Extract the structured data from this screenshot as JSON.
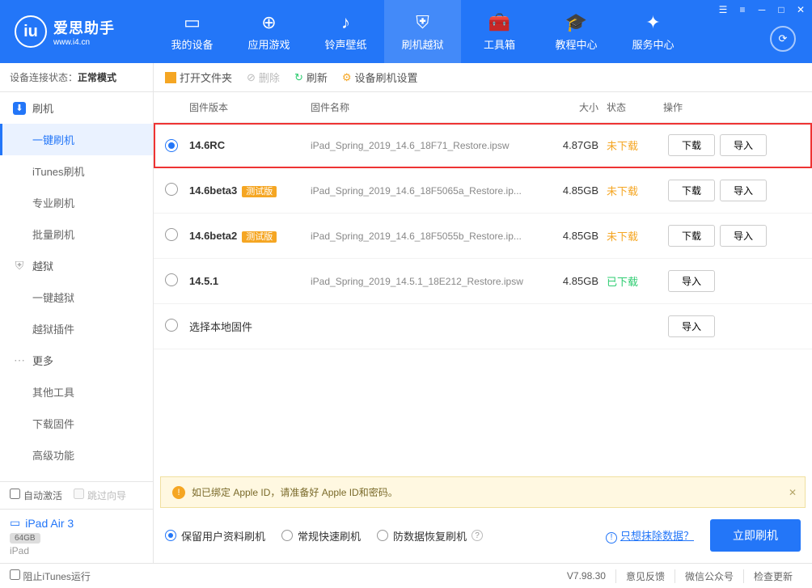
{
  "app": {
    "name": "爱思助手",
    "url": "www.i4.cn"
  },
  "nav": [
    {
      "label": "我的设备"
    },
    {
      "label": "应用游戏"
    },
    {
      "label": "铃声壁纸"
    },
    {
      "label": "刷机越狱"
    },
    {
      "label": "工具箱"
    },
    {
      "label": "教程中心"
    },
    {
      "label": "服务中心"
    }
  ],
  "status": {
    "prefix": "设备连接状态：",
    "value": "正常模式"
  },
  "sidebar": {
    "g1": "刷机",
    "items1": [
      "一键刷机",
      "iTunes刷机",
      "专业刷机",
      "批量刷机"
    ],
    "g2": "越狱",
    "items2": [
      "一键越狱",
      "越狱插件"
    ],
    "g3": "更多",
    "items3": [
      "其他工具",
      "下载固件",
      "高级功能"
    ],
    "auto_activate": "自动激活",
    "skip_guide": "跳过向导"
  },
  "device": {
    "name": "iPad Air 3",
    "storage": "64GB",
    "type": "iPad"
  },
  "toolbar": {
    "open": "打开文件夹",
    "delete": "删除",
    "refresh": "刷新",
    "settings": "设备刷机设置"
  },
  "columns": {
    "version": "固件版本",
    "name": "固件名称",
    "size": "大小",
    "status": "状态",
    "ops": "操作"
  },
  "rows": [
    {
      "ver": "14.6RC",
      "badge": "",
      "name": "iPad_Spring_2019_14.6_18F71_Restore.ipsw",
      "size": "4.87GB",
      "status": "未下载",
      "downloaded": false,
      "selected": true,
      "highlight": true
    },
    {
      "ver": "14.6beta3",
      "badge": "测试版",
      "name": "iPad_Spring_2019_14.6_18F5065a_Restore.ip...",
      "size": "4.85GB",
      "status": "未下载",
      "downloaded": false,
      "selected": false
    },
    {
      "ver": "14.6beta2",
      "badge": "测试版",
      "name": "iPad_Spring_2019_14.6_18F5055b_Restore.ip...",
      "size": "4.85GB",
      "status": "未下载",
      "downloaded": false,
      "selected": false
    },
    {
      "ver": "14.5.1",
      "badge": "",
      "name": "iPad_Spring_2019_14.5.1_18E212_Restore.ipsw",
      "size": "4.85GB",
      "status": "已下载",
      "downloaded": true,
      "selected": false
    }
  ],
  "local_row": "选择本地固件",
  "btn": {
    "download": "下载",
    "import": "导入"
  },
  "notice": "如已绑定 Apple ID，请准备好 Apple ID和密码。",
  "options": {
    "keep": "保留用户资料刷机",
    "normal": "常规快速刷机",
    "anti": "防数据恢复刷机",
    "erase_link": "只想抹除数据？",
    "flash": "立即刷机"
  },
  "footer": {
    "block_itunes": "阻止iTunes运行",
    "version": "V7.98.30",
    "feedback": "意见反馈",
    "wechat": "微信公众号",
    "update": "检查更新"
  }
}
